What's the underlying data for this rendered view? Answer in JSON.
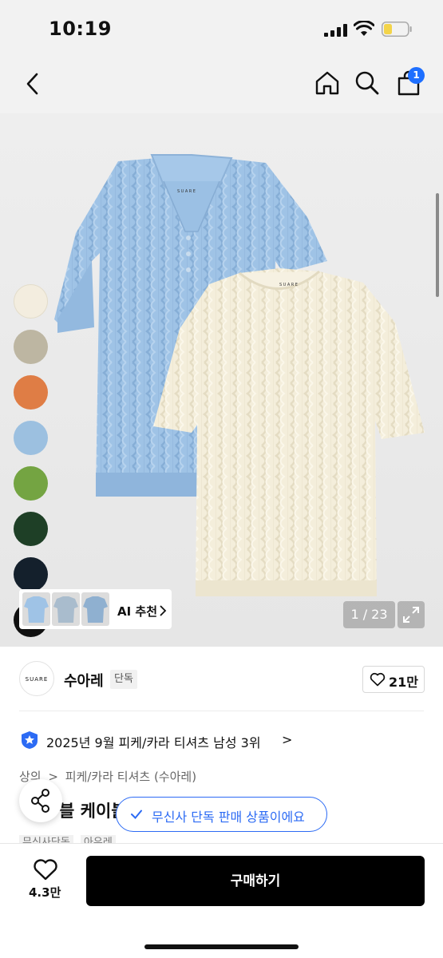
{
  "status_bar": {
    "time": "10:19"
  },
  "nav": {
    "cart_count": "1"
  },
  "hero": {
    "brand_label_1": "SUARE",
    "brand_label_2": "SUARE",
    "color_swatches": [
      "#f3eddf",
      "#bdb6a2",
      "#df7d45",
      "#9cc0e0",
      "#74a442",
      "#1e3f26",
      "#14202c",
      "#101010"
    ],
    "ai_label": "AI 추천",
    "counter": "1 / 23"
  },
  "brand": {
    "logo_text": "SUARE",
    "name": "수아레",
    "tag": "단독",
    "likes": "21만"
  },
  "ranking": {
    "text": "2025년 9월 피케/카라 티셔츠 남성 3위",
    "chevron": ">"
  },
  "breadcrumb": {
    "root": "상의",
    "sep": ">",
    "leaf": "피케/카라 티셔츠 (수아레)"
  },
  "product": {
    "title_partial": "블 케이블"
  },
  "toast": {
    "text": "무신사 단독 판매 상품이에요"
  },
  "tags": [
    "무신사단독",
    "아우레"
  ],
  "bottom_bar": {
    "wish_count": "4.3만",
    "buy_label": "구매하기"
  },
  "colors": {
    "accent": "#2c6bf4",
    "badge": "#1e6fff",
    "buy_button": "#000000"
  }
}
